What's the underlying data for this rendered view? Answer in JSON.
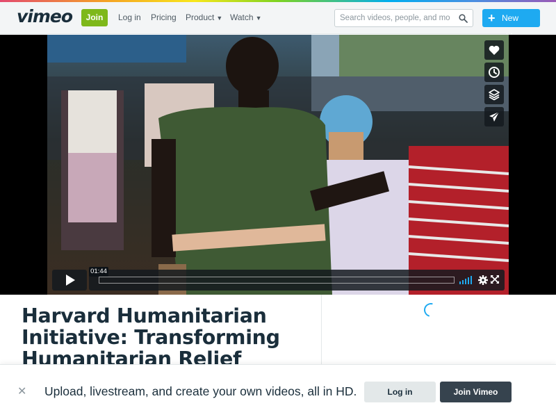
{
  "header": {
    "logo": "vimeo",
    "join_label": "Join",
    "nav": {
      "login": "Log in",
      "pricing": "Pricing",
      "product": "Product",
      "watch": "Watch"
    },
    "search_placeholder": "Search videos, people, and more",
    "new_video_label": "New video"
  },
  "player": {
    "timecode": "01:44",
    "side_actions": [
      "heart-icon",
      "clock-icon",
      "layers-icon",
      "send-icon"
    ]
  },
  "video": {
    "title": "Harvard Humanitarian Initiative: Transforming Humanitarian Relief Efforts"
  },
  "banner": {
    "text": "Upload, livestream, and create your own videos, all in HD.",
    "login_label": "Log in",
    "join_label": "Join Vimeo"
  },
  "colors": {
    "join_green": "#7eb81a",
    "accent_blue": "#1eaaf1",
    "dark_button": "#36434e"
  }
}
